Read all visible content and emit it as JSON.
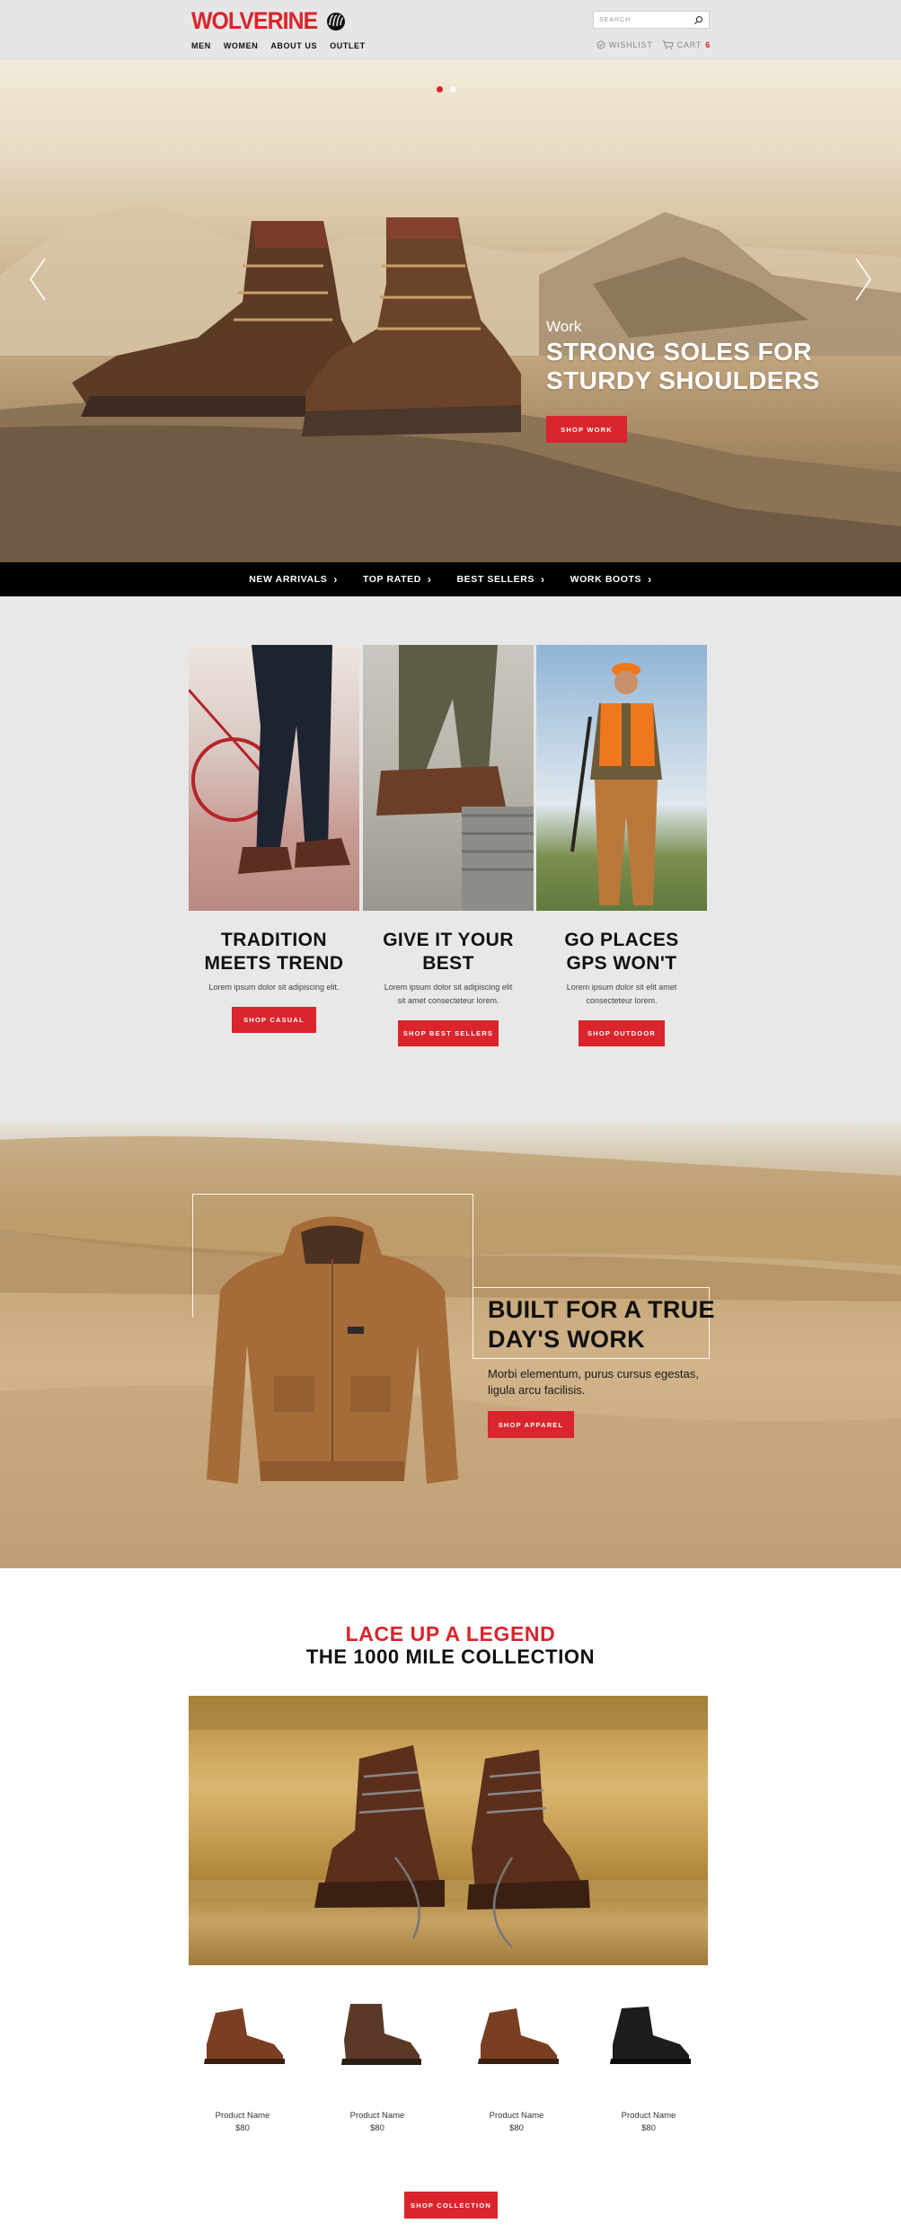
{
  "header": {
    "brand": "WOLVERINE",
    "search_placeholder": "SEARCH",
    "nav": [
      "MEN",
      "WOMEN",
      "ABOUT US",
      "OUTLET"
    ],
    "wishlist": "WISHLIST",
    "cart": "CART",
    "cart_count": "6"
  },
  "hero": {
    "eyebrow": "Work",
    "title_line1": "STRONG SOLES FOR",
    "title_line2": "STURDY SHOULDERS",
    "button": "SHOP WORK",
    "slide_count": 2,
    "active_slide": 1
  },
  "category_bar": [
    "NEW ARRIVALS",
    "TOP RATED",
    "BEST SELLERS",
    "WORK BOOTS"
  ],
  "tiles": [
    {
      "title_line1": "TRADITION",
      "title_line2": "MEETS TREND",
      "text": "Lorem ipsum dolor sit adipiscing elit.",
      "button": "SHOP CASUAL"
    },
    {
      "title_line1": "GIVE IT YOUR",
      "title_line2": "BEST",
      "text": "Lorem ipsum dolor sit adipiscing elit sit amet consecteteur lorem.",
      "button": "SHOP BEST SELLERS"
    },
    {
      "title_line1": "GO PLACES",
      "title_line2": "GPS WON'T",
      "text": "Lorem ipsum dolor sit elit amet consecteteur lorem.",
      "button": "SHOP OUTDOOR"
    }
  ],
  "apparel": {
    "title_line1": "BUILT FOR A TRUE",
    "title_line2": "DAY'S WORK",
    "text": "Morbi elementum, purus cursus egestas, ligula arcu facilisis.",
    "button": "SHOP APPAREL"
  },
  "collection": {
    "kicker": "LACE UP A LEGEND",
    "title": "THE 1000 MILE COLLECTION",
    "products": [
      {
        "name": "Product Name",
        "price": "$80",
        "color": "#7a3f22"
      },
      {
        "name": "Product Name",
        "price": "$80",
        "color": "#5a3a26"
      },
      {
        "name": "Product Name",
        "price": "$80",
        "color": "#7a3f22"
      },
      {
        "name": "Product Name",
        "price": "$80",
        "color": "#1c1c1c"
      }
    ],
    "button": "SHOP COLLECTION"
  },
  "colors": {
    "brand_red": "#d9252b",
    "bar_black": "#000000",
    "section_gray": "#e8e8e8"
  }
}
